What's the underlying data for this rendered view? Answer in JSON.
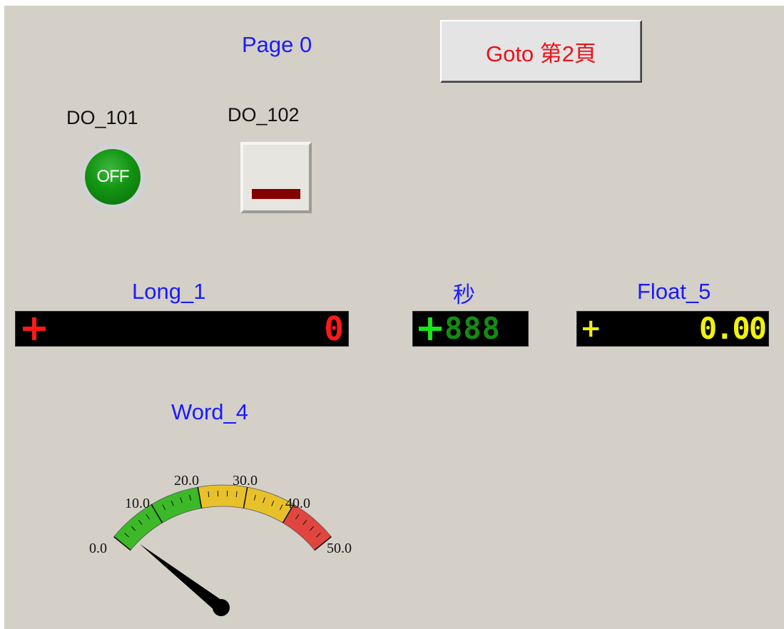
{
  "page_title": "Page 0",
  "goto_button": {
    "label": "Goto 第2頁"
  },
  "do_101": {
    "label": "DO_101",
    "lamp_text": "OFF",
    "state": "off",
    "color": "#129412"
  },
  "do_102": {
    "label": "DO_102",
    "indicator_color": "#850000"
  },
  "long_1": {
    "label": "Long_1",
    "sign": "+",
    "value": "0",
    "color": "#ff1a1a"
  },
  "seconds": {
    "label": "秒",
    "sign": "+",
    "value": "888",
    "color": "#19e619"
  },
  "float_5": {
    "label": "Float_5",
    "sign": "+",
    "value": "0.00",
    "color": "#f2f20a"
  },
  "word_4": {
    "label": "Word_4",
    "value": 0.0,
    "gauge_min": 0.0,
    "gauge_max": 50.0,
    "tick_labels": [
      "0.0",
      "10.0",
      "20.0",
      "30.0",
      "40.0",
      "50.0"
    ],
    "zones": [
      {
        "from": 0,
        "to": 20,
        "color": "#3cb829"
      },
      {
        "from": 20,
        "to": 40,
        "color": "#e8c12a"
      },
      {
        "from": 40,
        "to": 50,
        "color": "#e0463f"
      }
    ]
  },
  "colors": {
    "panel_bg": "#d4d0c8",
    "label_blue": "#1a1aff",
    "button_text_red": "#e8131b"
  }
}
